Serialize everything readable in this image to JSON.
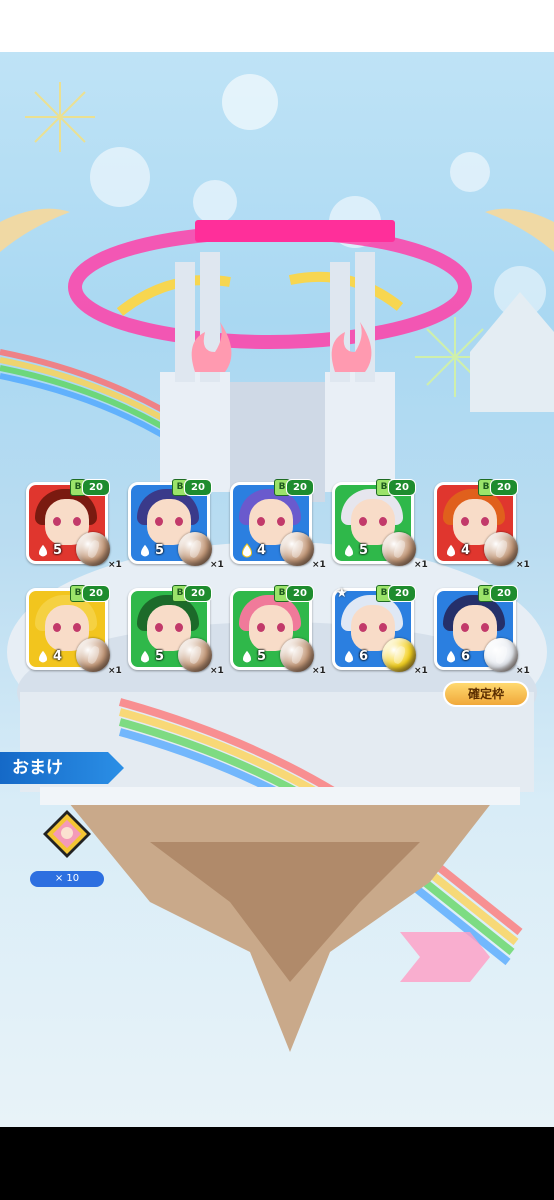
{
  "characters": [
    {
      "level": "20",
      "rank": "B",
      "lvnum": "5",
      "count": "×1",
      "element": "fire",
      "hair": "#7a1a10",
      "bg": "#e0362e",
      "gem": "#c59a7a"
    },
    {
      "level": "20",
      "rank": "B",
      "lvnum": "5",
      "count": "×1",
      "element": "water",
      "hair": "#3a3a8a",
      "bg": "#2b7fe0",
      "gem": "#c59a7a"
    },
    {
      "level": "20",
      "rank": "B",
      "lvnum": "4",
      "count": "×1",
      "element": "thunder",
      "hair": "#6a5acd",
      "bg": "#2b7fe0",
      "gem": "#c59a7a"
    },
    {
      "level": "20",
      "rank": "B",
      "lvnum": "5",
      "count": "×1",
      "element": "wood",
      "hair": "#e6e6ee",
      "bg": "#2fb84a",
      "gem": "#c59a7a"
    },
    {
      "level": "20",
      "rank": "B",
      "lvnum": "4",
      "count": "×1",
      "element": "fire",
      "hair": "#e0601c",
      "bg": "#e0362e",
      "gem": "#c59a7a"
    },
    {
      "level": "20",
      "rank": "B",
      "lvnum": "4",
      "count": "×1",
      "element": "light",
      "hair": "#f5d142",
      "bg": "#f2c51e",
      "gem": "#c59a7a"
    },
    {
      "level": "20",
      "rank": "B",
      "lvnum": "5",
      "count": "×1",
      "element": "wood",
      "hair": "#1c6a2a",
      "bg": "#2fb84a",
      "gem": "#c59a7a"
    },
    {
      "level": "20",
      "rank": "B",
      "lvnum": "5",
      "count": "×1",
      "element": "wood",
      "hair": "#f07a9a",
      "bg": "#2fb84a",
      "gem": "#c59a7a"
    },
    {
      "level": "20",
      "rank": "B",
      "lvnum": "6",
      "count": "×1",
      "element": "water",
      "hair": "#dfe8f5",
      "bg": "#2b7fe0",
      "gem": "#f5d21e",
      "star": true
    },
    {
      "level": "20",
      "rank": "B",
      "lvnum": "6",
      "count": "×1",
      "element": "water",
      "hair": "#25306a",
      "bg": "#2b7fe0",
      "gem": "#e8ecf2"
    }
  ],
  "confirm_label": "確定枠",
  "bonus": {
    "title": "おまけ",
    "count": "× 10"
  },
  "colors": {
    "accent": "#1569c7",
    "gold": "#f0a83a"
  }
}
